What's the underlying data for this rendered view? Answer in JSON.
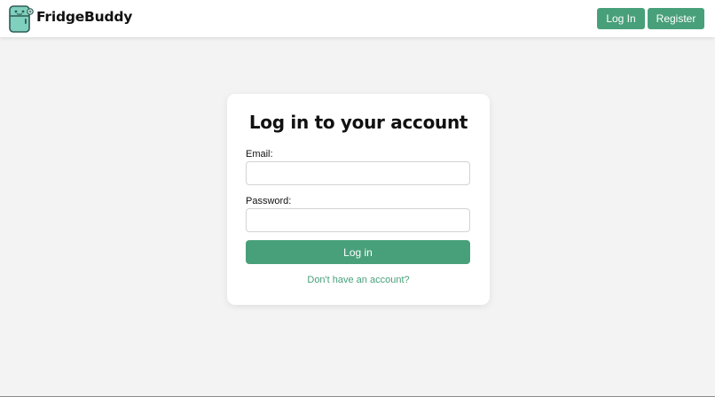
{
  "header": {
    "brand": "FridgeBuddy",
    "logo_icon": "fridge-mascot-icon",
    "login_label": "Log In",
    "register_label": "Register"
  },
  "login_form": {
    "title": "Log in to your account",
    "email_label": "Email:",
    "email_value": "",
    "password_label": "Password:",
    "password_value": "",
    "submit_label": "Log in",
    "register_link": "Don't have an account?"
  },
  "colors": {
    "accent": "#48a07a",
    "page_background": "#f3f3f3",
    "card_background": "#ffffff"
  }
}
